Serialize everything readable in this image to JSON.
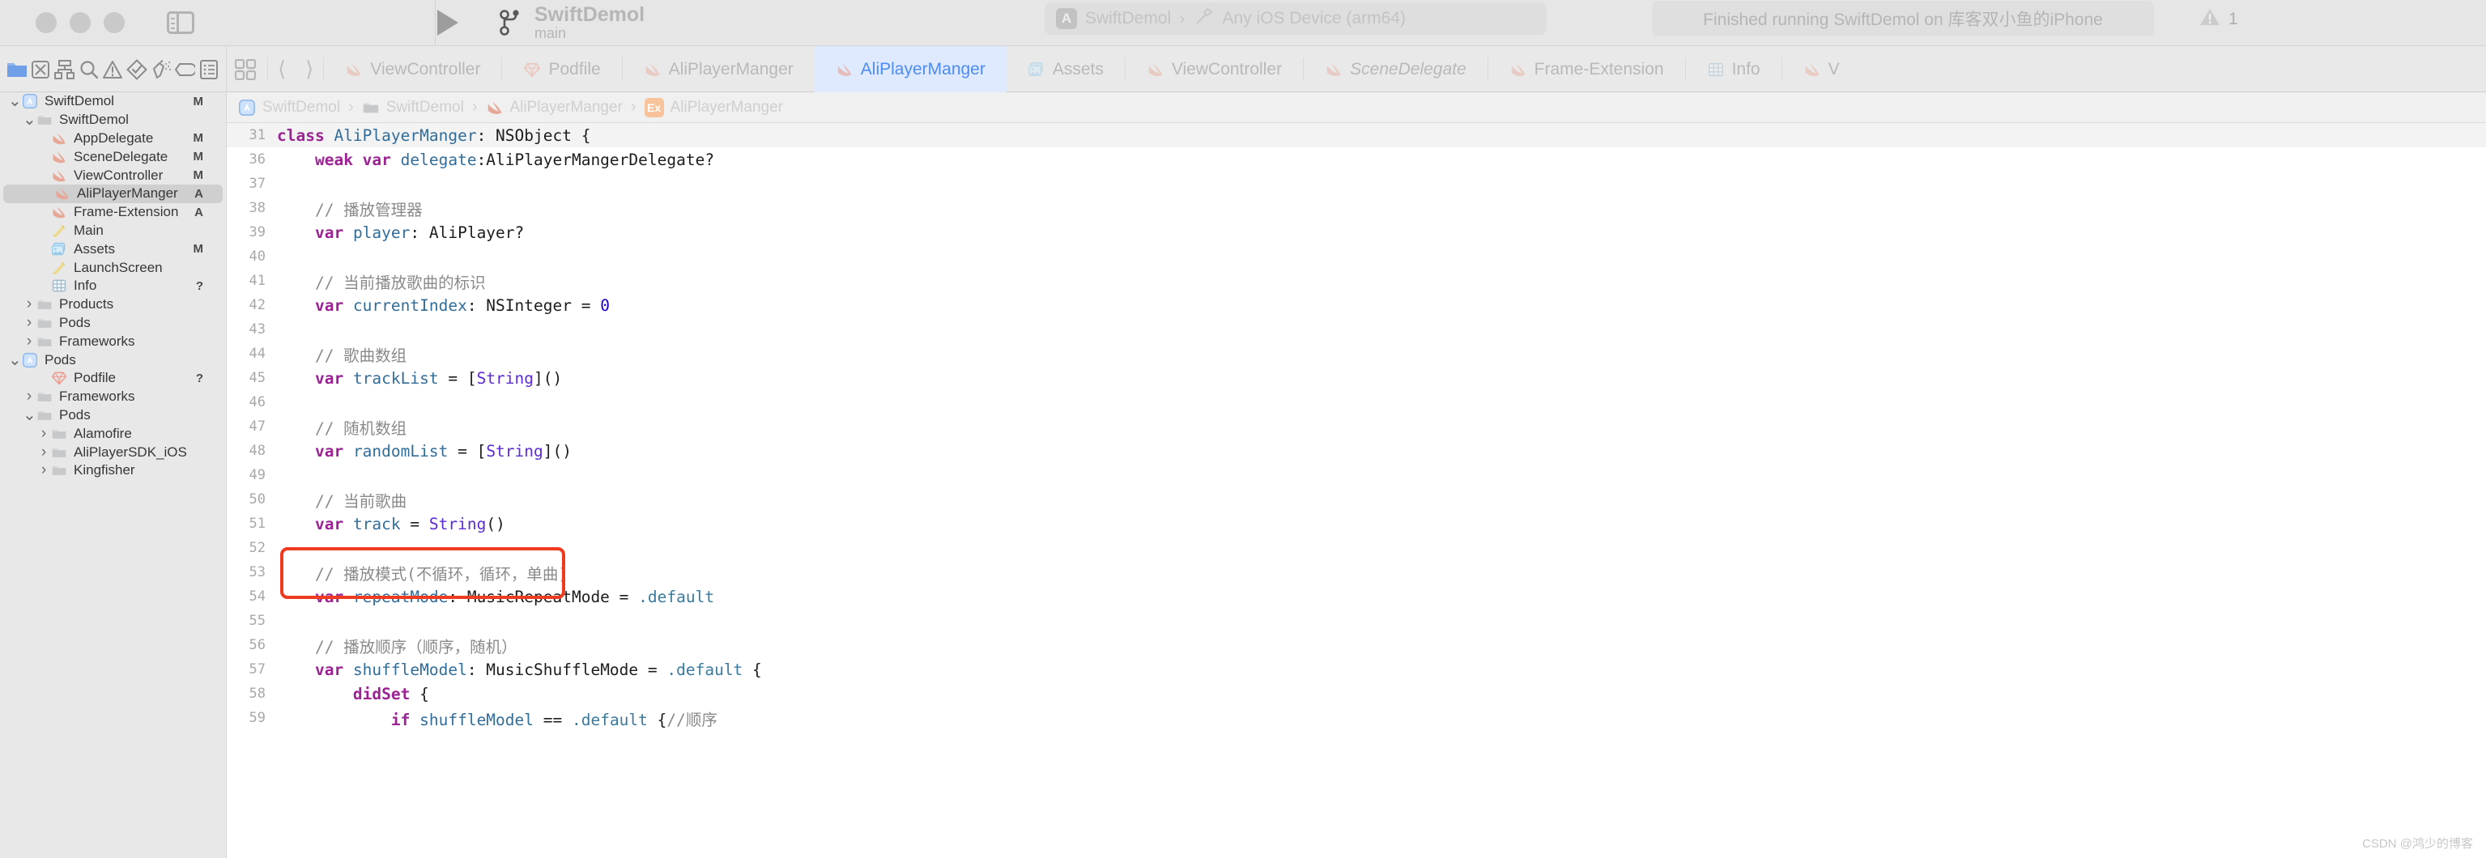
{
  "toolbar": {
    "project_title": "SwiftDemol",
    "branch": "main",
    "branch_icon": "branch-icon",
    "run_icon": "play-icon",
    "sidebar_toggle_icon": "sidebar-toggle-icon",
    "scheme": {
      "app_badge": "A",
      "app_name": "SwiftDemol",
      "separator": "›",
      "destination_icon": "hammer-icon",
      "destination": "Any iOS Device (arm64)"
    },
    "status": "Finished running SwiftDemol on 库客双小鱼的iPhone",
    "warning_icon": "warning-icon",
    "warning_count": "1"
  },
  "navigator_icons": [
    {
      "name": "folder-icon",
      "active": true
    },
    {
      "name": "source-control-icon",
      "active": false
    },
    {
      "name": "symbol-hierarchy-icon",
      "active": false
    },
    {
      "name": "search-icon",
      "active": false
    },
    {
      "name": "issue-warning-icon",
      "active": false
    },
    {
      "name": "test-icon",
      "active": false
    },
    {
      "name": "debug-icon",
      "active": false
    },
    {
      "name": "breakpoint-icon",
      "active": false
    },
    {
      "name": "report-icon",
      "active": false
    }
  ],
  "tabstrip": {
    "grid_icon": "tab-grid-icon",
    "back_icon": "chevron-left-icon",
    "forward_icon": "chevron-right-icon",
    "tabs": [
      {
        "label": "ViewController",
        "icon": "swift-icon",
        "active": false,
        "italic": false
      },
      {
        "label": "Podfile",
        "icon": "ruby-icon",
        "active": false,
        "italic": false
      },
      {
        "label": "AliPlayerManger",
        "icon": "swift-icon",
        "active": false,
        "italic": false
      },
      {
        "label": "AliPlayerManger",
        "icon": "swift-icon",
        "active": true,
        "italic": false
      },
      {
        "label": "Assets",
        "icon": "assets-icon",
        "active": false,
        "italic": false
      },
      {
        "label": "ViewController",
        "icon": "swift-icon",
        "active": false,
        "italic": false
      },
      {
        "label": "SceneDelegate",
        "icon": "swift-icon",
        "active": false,
        "italic": true
      },
      {
        "label": "Frame-Extension",
        "icon": "swift-icon",
        "active": false,
        "italic": false
      },
      {
        "label": "Info",
        "icon": "plist-icon",
        "active": false,
        "italic": false
      },
      {
        "label": "V",
        "icon": "swift-icon",
        "active": false,
        "italic": false
      }
    ]
  },
  "sidebar": {
    "rows": [
      {
        "label": "SwiftDemol",
        "icon": "app-project-icon",
        "disclosure": "down",
        "indent": 0,
        "status": "M",
        "selected": false
      },
      {
        "label": "SwiftDemol",
        "icon": "folder-icon",
        "disclosure": "down",
        "indent": 1,
        "status": "",
        "selected": false
      },
      {
        "label": "AppDelegate",
        "icon": "swift-icon",
        "disclosure": "none",
        "indent": 2,
        "status": "M",
        "selected": false
      },
      {
        "label": "SceneDelegate",
        "icon": "swift-icon",
        "disclosure": "none",
        "indent": 2,
        "status": "M",
        "selected": false
      },
      {
        "label": "ViewController",
        "icon": "swift-icon",
        "disclosure": "none",
        "indent": 2,
        "status": "M",
        "selected": false
      },
      {
        "label": "AliPlayerManger",
        "icon": "swift-icon",
        "disclosure": "none",
        "indent": 2,
        "status": "A",
        "selected": true
      },
      {
        "label": "Frame-Extension",
        "icon": "swift-icon",
        "disclosure": "none",
        "indent": 2,
        "status": "A",
        "selected": false
      },
      {
        "label": "Main",
        "icon": "storyboard-icon",
        "disclosure": "none",
        "indent": 2,
        "status": "",
        "selected": false
      },
      {
        "label": "Assets",
        "icon": "assets-icon",
        "disclosure": "none",
        "indent": 2,
        "status": "M",
        "selected": false
      },
      {
        "label": "LaunchScreen",
        "icon": "storyboard-icon",
        "disclosure": "none",
        "indent": 2,
        "status": "",
        "selected": false
      },
      {
        "label": "Info",
        "icon": "plist-icon",
        "disclosure": "none",
        "indent": 2,
        "status": "?",
        "selected": false
      },
      {
        "label": "Products",
        "icon": "folder-icon",
        "disclosure": "right",
        "indent": 1,
        "status": "",
        "selected": false
      },
      {
        "label": "Pods",
        "icon": "folder-icon",
        "disclosure": "right",
        "indent": 1,
        "status": "",
        "selected": false
      },
      {
        "label": "Frameworks",
        "icon": "folder-icon",
        "disclosure": "right",
        "indent": 1,
        "status": "",
        "selected": false
      },
      {
        "label": "Pods",
        "icon": "app-project-icon",
        "disclosure": "down",
        "indent": 0,
        "status": "",
        "selected": false
      },
      {
        "label": "Podfile",
        "icon": "ruby-icon",
        "disclosure": "none",
        "indent": 2,
        "status": "?",
        "selected": false
      },
      {
        "label": "Frameworks",
        "icon": "folder-icon",
        "disclosure": "right",
        "indent": 1,
        "status": "",
        "selected": false
      },
      {
        "label": "Pods",
        "icon": "folder-icon",
        "disclosure": "down",
        "indent": 1,
        "status": "",
        "selected": false
      },
      {
        "label": "Alamofire",
        "icon": "folder-icon",
        "disclosure": "right",
        "indent": 2,
        "status": "",
        "selected": false
      },
      {
        "label": "AliPlayerSDK_iOS",
        "icon": "folder-icon",
        "disclosure": "right",
        "indent": 2,
        "status": "",
        "selected": false
      },
      {
        "label": "Kingfisher",
        "icon": "folder-icon",
        "disclosure": "right",
        "indent": 2,
        "status": "",
        "selected": false
      }
    ]
  },
  "jumpbar": {
    "crumbs": [
      {
        "label": "SwiftDemol",
        "icon": "app-project-icon"
      },
      {
        "label": "SwiftDemol",
        "icon": "folder-icon"
      },
      {
        "label": "AliPlayerManger",
        "icon": "swift-icon"
      },
      {
        "label": "AliPlayerManger",
        "icon": "extension-badge-icon"
      }
    ],
    "separator": "›"
  },
  "code": {
    "lines": [
      {
        "num": "31",
        "highlight": true,
        "tokens": [
          {
            "t": "class ",
            "c": "kw"
          },
          {
            "t": "AliPlayerManger",
            "c": "id"
          },
          {
            "t": ": NSObject {",
            "c": "ty"
          }
        ]
      },
      {
        "num": "36",
        "highlight": false,
        "tokens": [
          {
            "t": "    ",
            "c": "ty"
          },
          {
            "t": "weak var ",
            "c": "kw"
          },
          {
            "t": "delegate",
            "c": "id"
          },
          {
            "t": ":AliPlayerMangerDelegate?",
            "c": "ty"
          }
        ]
      },
      {
        "num": "37",
        "highlight": false,
        "tokens": [
          {
            "t": "",
            "c": "ty"
          }
        ]
      },
      {
        "num": "38",
        "highlight": false,
        "tokens": [
          {
            "t": "    // 播放管理器",
            "c": "cm"
          }
        ]
      },
      {
        "num": "39",
        "highlight": false,
        "tokens": [
          {
            "t": "    ",
            "c": "ty"
          },
          {
            "t": "var ",
            "c": "kw"
          },
          {
            "t": "player",
            "c": "id"
          },
          {
            "t": ": AliPlayer?",
            "c": "ty"
          }
        ]
      },
      {
        "num": "40",
        "highlight": false,
        "tokens": [
          {
            "t": "",
            "c": "ty"
          }
        ]
      },
      {
        "num": "41",
        "highlight": false,
        "tokens": [
          {
            "t": "    // 当前播放歌曲的标识",
            "c": "cm"
          }
        ]
      },
      {
        "num": "42",
        "highlight": false,
        "tokens": [
          {
            "t": "    ",
            "c": "ty"
          },
          {
            "t": "var ",
            "c": "kw"
          },
          {
            "t": "currentIndex",
            "c": "id"
          },
          {
            "t": ": NSInteger = ",
            "c": "ty"
          },
          {
            "t": "0",
            "c": "num"
          }
        ]
      },
      {
        "num": "43",
        "highlight": false,
        "tokens": [
          {
            "t": "",
            "c": "ty"
          }
        ]
      },
      {
        "num": "44",
        "highlight": false,
        "tokens": [
          {
            "t": "    // 歌曲数组",
            "c": "cm"
          }
        ]
      },
      {
        "num": "45",
        "highlight": false,
        "tokens": [
          {
            "t": "    ",
            "c": "ty"
          },
          {
            "t": "var ",
            "c": "kw"
          },
          {
            "t": "trackList",
            "c": "id"
          },
          {
            "t": " = [",
            "c": "ty"
          },
          {
            "t": "String",
            "c": "tyb"
          },
          {
            "t": "]()",
            "c": "ty"
          }
        ]
      },
      {
        "num": "46",
        "highlight": false,
        "tokens": [
          {
            "t": "",
            "c": "ty"
          }
        ]
      },
      {
        "num": "47",
        "highlight": false,
        "tokens": [
          {
            "t": "    // 随机数组",
            "c": "cm"
          }
        ]
      },
      {
        "num": "48",
        "highlight": false,
        "tokens": [
          {
            "t": "    ",
            "c": "ty"
          },
          {
            "t": "var ",
            "c": "kw"
          },
          {
            "t": "randomList",
            "c": "id"
          },
          {
            "t": " = [",
            "c": "ty"
          },
          {
            "t": "String",
            "c": "tyb"
          },
          {
            "t": "]()",
            "c": "ty"
          }
        ]
      },
      {
        "num": "49",
        "highlight": false,
        "tokens": [
          {
            "t": "",
            "c": "ty"
          }
        ]
      },
      {
        "num": "50",
        "highlight": false,
        "tokens": [
          {
            "t": "    // 当前歌曲",
            "c": "cm"
          }
        ]
      },
      {
        "num": "51",
        "highlight": false,
        "tokens": [
          {
            "t": "    ",
            "c": "ty"
          },
          {
            "t": "var ",
            "c": "kw"
          },
          {
            "t": "track",
            "c": "id"
          },
          {
            "t": " = ",
            "c": "ty"
          },
          {
            "t": "String",
            "c": "tyb"
          },
          {
            "t": "()",
            "c": "ty"
          }
        ]
      },
      {
        "num": "52",
        "highlight": false,
        "tokens": [
          {
            "t": "",
            "c": "ty"
          }
        ]
      },
      {
        "num": "53",
        "highlight": false,
        "tokens": [
          {
            "t": "    // 播放模式(不循环，循环，单曲)",
            "c": "cm"
          }
        ]
      },
      {
        "num": "54",
        "highlight": false,
        "tokens": [
          {
            "t": "    ",
            "c": "ty"
          },
          {
            "t": "var ",
            "c": "kw"
          },
          {
            "t": "repeatMode",
            "c": "id"
          },
          {
            "t": ": MusicRepeatMode = ",
            "c": "ty"
          },
          {
            "t": ".default",
            "c": "mem"
          }
        ]
      },
      {
        "num": "55",
        "highlight": false,
        "tokens": [
          {
            "t": "",
            "c": "ty"
          }
        ]
      },
      {
        "num": "56",
        "highlight": false,
        "tokens": [
          {
            "t": "    // 播放顺序（顺序，随机）",
            "c": "cm"
          }
        ]
      },
      {
        "num": "57",
        "highlight": false,
        "tokens": [
          {
            "t": "    ",
            "c": "ty"
          },
          {
            "t": "var ",
            "c": "kw"
          },
          {
            "t": "shuffleModel",
            "c": "id"
          },
          {
            "t": ": MusicShuffleMode = ",
            "c": "ty"
          },
          {
            "t": ".default",
            "c": "mem"
          },
          {
            "t": " {",
            "c": "ty"
          }
        ]
      },
      {
        "num": "58",
        "highlight": false,
        "tokens": [
          {
            "t": "        ",
            "c": "ty"
          },
          {
            "t": "didSet",
            "c": "kw"
          },
          {
            "t": " {",
            "c": "ty"
          }
        ]
      },
      {
        "num": "59",
        "highlight": false,
        "tokens": [
          {
            "t": "            ",
            "c": "ty"
          },
          {
            "t": "if ",
            "c": "kw"
          },
          {
            "t": "shuffleModel",
            "c": "id"
          },
          {
            "t": " == ",
            "c": "ty"
          },
          {
            "t": ".default",
            "c": "mem"
          },
          {
            "t": " {",
            "c": "ty"
          },
          {
            "t": "//顺序",
            "c": "cm"
          }
        ]
      }
    ]
  },
  "annotation": {
    "color": "#ef3b1f",
    "highlighted_lines": "53-54"
  },
  "watermark": "CSDN @鸿少的博客"
}
